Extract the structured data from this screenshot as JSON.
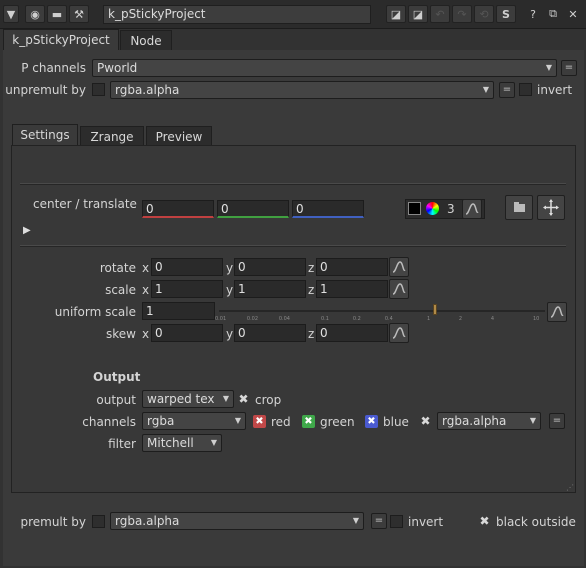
{
  "titlebar": {
    "node_name": "k_pStickyProject",
    "help_label": "?",
    "s_label": "S"
  },
  "tabs": [
    {
      "label": "k_pStickyProject",
      "active": true
    },
    {
      "label": "Node",
      "active": false
    }
  ],
  "p_channels": {
    "label": "P channels",
    "value": "Pworld"
  },
  "unpremult_by": {
    "label": "unpremult by",
    "value": "rgba.alpha",
    "invert_label": "invert"
  },
  "subtabs": [
    {
      "label": "Settings",
      "active": true
    },
    {
      "label": "Zrange",
      "active": false
    },
    {
      "label": "Preview",
      "active": false
    }
  ],
  "center_translate": {
    "label": "center / translate",
    "x": "0",
    "y": "0",
    "z": "0",
    "count": "3",
    "colors": {
      "x": "#c04040",
      "y": "#40a040",
      "z": "#4060c0"
    }
  },
  "rotate": {
    "label": "rotate",
    "x": "0",
    "y": "0",
    "z": "0"
  },
  "scale": {
    "label": "scale",
    "x": "1",
    "y": "1",
    "z": "1"
  },
  "uniform_scale": {
    "label": "uniform scale",
    "value": "1",
    "ticks": [
      "0.01",
      "0.02",
      "0.04",
      "0.1",
      "0.2",
      "0.4",
      "1",
      "2",
      "4",
      "10"
    ]
  },
  "skew": {
    "label": "skew",
    "x": "0",
    "y": "0",
    "z": "0"
  },
  "axes": {
    "x": "x",
    "y": "y",
    "z": "z"
  },
  "output_section": {
    "title": "Output",
    "output": {
      "label": "output",
      "value": "warped tex",
      "crop_label": "crop"
    },
    "channels": {
      "label": "channels",
      "value": "rgba",
      "red": "red",
      "green": "green",
      "blue": "blue",
      "alpha_value": "rgba.alpha",
      "colors": {
        "red": "#d04040",
        "green": "#40b040",
        "blue": "#4060d0"
      }
    },
    "filter": {
      "label": "filter",
      "value": "Mitchell"
    }
  },
  "premult_by": {
    "label": "premult by",
    "value": "rgba.alpha",
    "invert_label": "invert",
    "black_outside_label": "black outside"
  }
}
